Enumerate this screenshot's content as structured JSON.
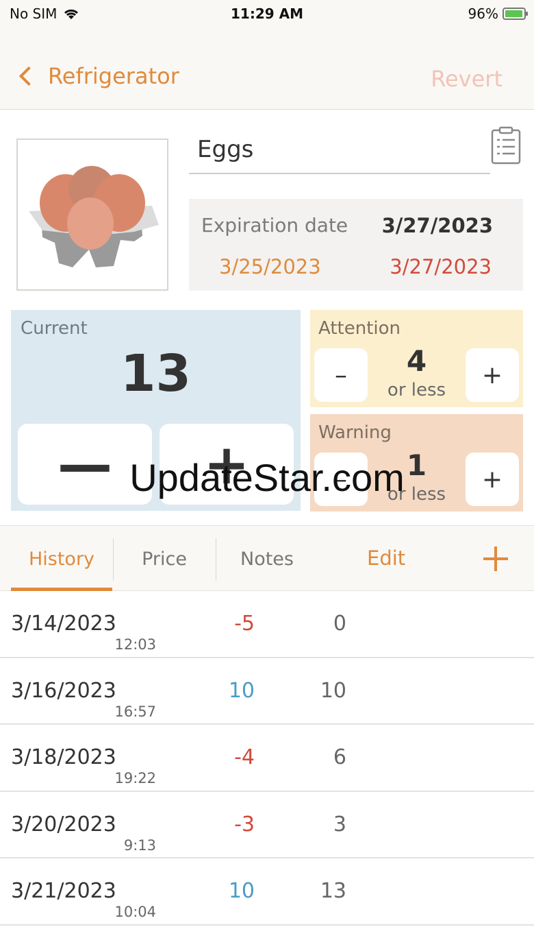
{
  "status_bar": {
    "carrier": "No SIM",
    "time": "11:29 AM",
    "battery": "96%",
    "battery_level": 0.96
  },
  "nav": {
    "back_label": "Refrigerator",
    "revert_label": "Revert"
  },
  "item": {
    "name": "Eggs",
    "expiration_label": "Expiration date",
    "expiration_date": "3/27/2023",
    "expiration_low": "3/25/2023",
    "expiration_high": "3/27/2023"
  },
  "current": {
    "label": "Current",
    "value": "13",
    "minus": "—",
    "plus": "+"
  },
  "attention": {
    "label": "Attention",
    "value": "4",
    "sub": "or less",
    "minus": "–",
    "plus": "+"
  },
  "warning": {
    "label": "Warning",
    "value": "1",
    "sub": "or less",
    "minus": "–",
    "plus": "+"
  },
  "watermark": "UpdateStar.com",
  "tabs": {
    "history": "History",
    "price": "Price",
    "notes": "Notes",
    "edit": "Edit"
  },
  "history": [
    {
      "date": "3/14/2023",
      "time": "12:03",
      "delta": "-5",
      "total": "0"
    },
    {
      "date": "3/16/2023",
      "time": "16:57",
      "delta": "10",
      "total": "10"
    },
    {
      "date": "3/18/2023",
      "time": "19:22",
      "delta": "-4",
      "total": "6"
    },
    {
      "date": "3/20/2023",
      "time": "9:13",
      "delta": "-3",
      "total": "3"
    },
    {
      "date": "3/21/2023",
      "time": "10:04",
      "delta": "10",
      "total": "13"
    }
  ],
  "colors": {
    "accent": "#e08a3c",
    "negative": "#d24a3b",
    "positive": "#4a9bc7"
  }
}
